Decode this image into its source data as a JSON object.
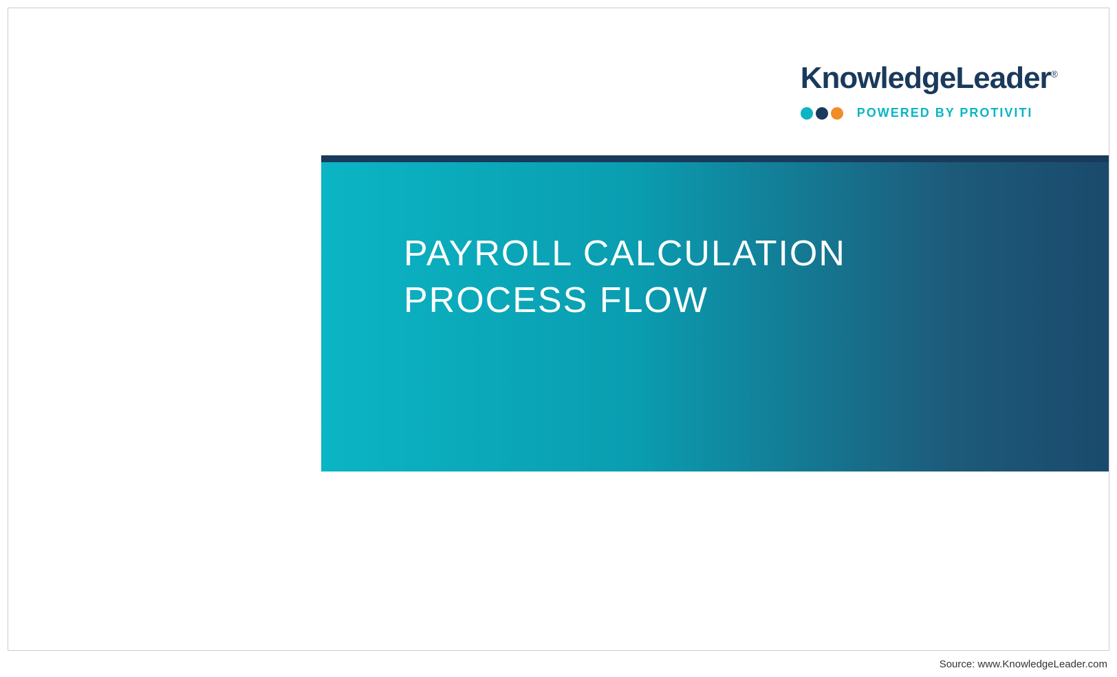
{
  "logo": {
    "brand": "KnowledgeLeader",
    "registered": "®",
    "tagline": "POWERED BY PROTIVITI"
  },
  "slide": {
    "title_line1": "PAYROLL CALCULATION",
    "title_line2": "PROCESS FLOW"
  },
  "footer": {
    "source": "Source: www.KnowledgeLeader.com"
  },
  "colors": {
    "brand_navy": "#1a3a5c",
    "brand_teal": "#0bb5c4",
    "brand_orange": "#f28c28"
  }
}
